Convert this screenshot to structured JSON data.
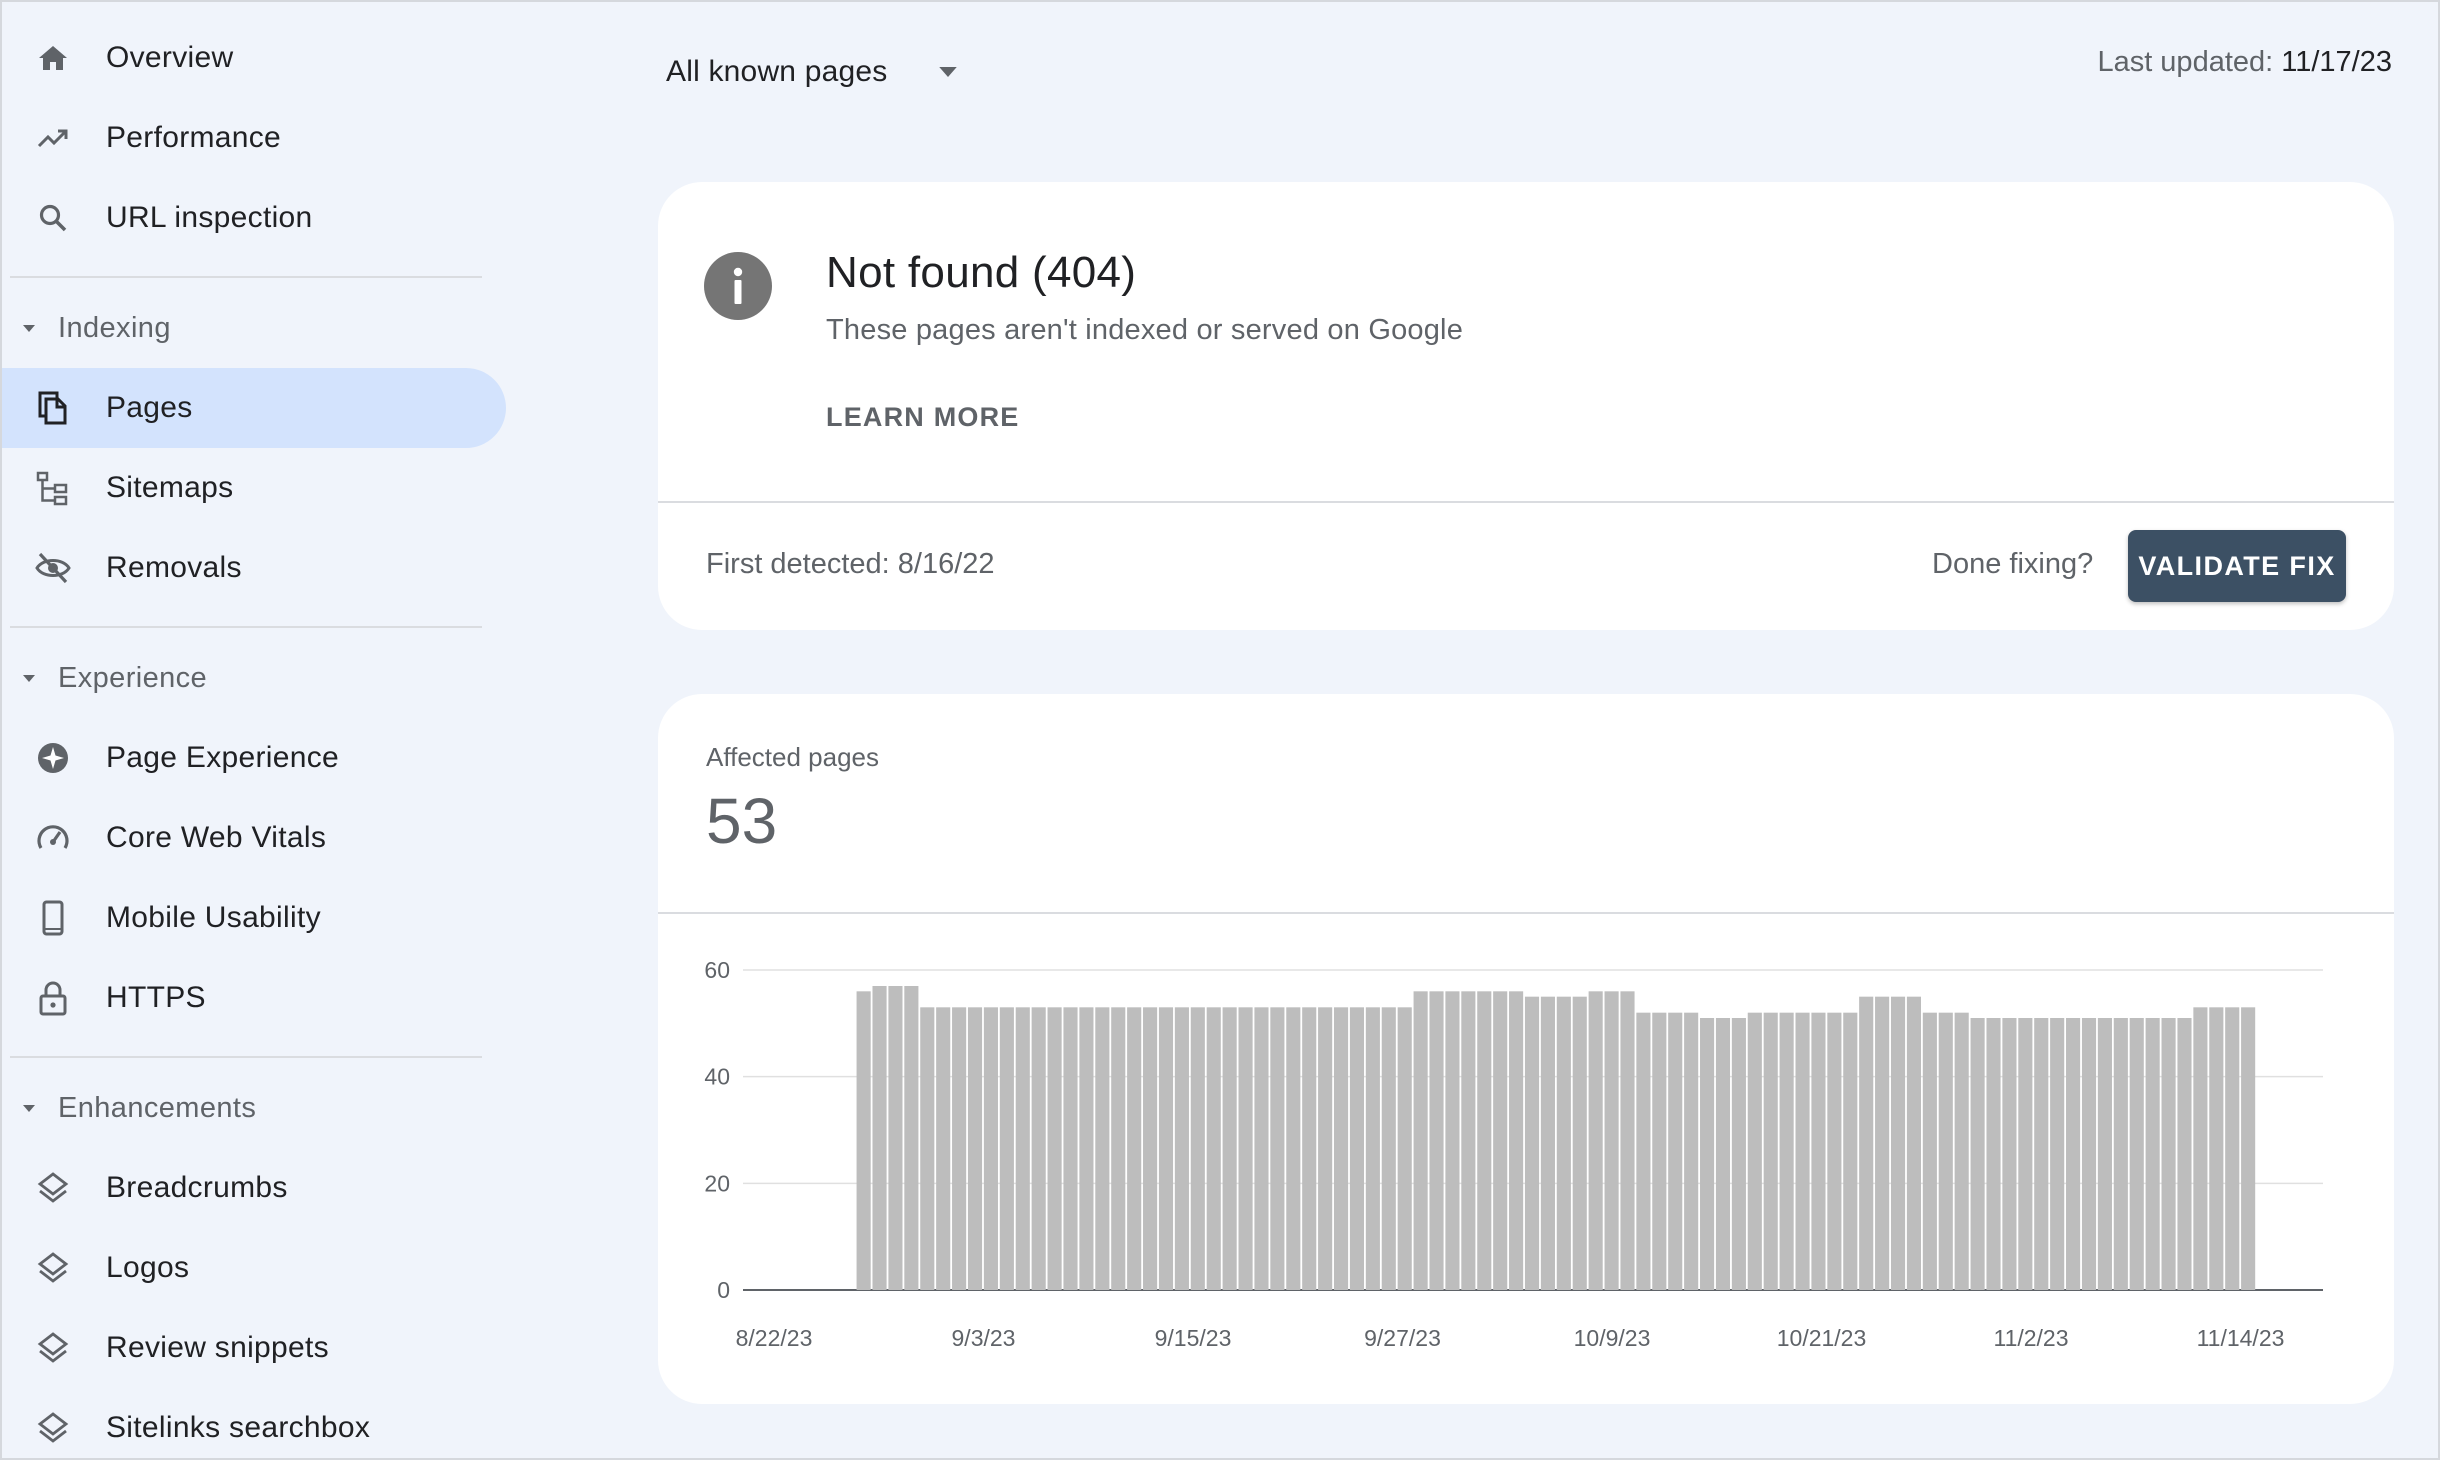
{
  "sidebar": {
    "top_items": [
      {
        "label": "Overview",
        "icon": "home-icon"
      },
      {
        "label": "Performance",
        "icon": "trending-up-icon"
      },
      {
        "label": "URL inspection",
        "icon": "search-icon"
      }
    ],
    "sections": [
      {
        "label": "Indexing",
        "items": [
          {
            "label": "Pages",
            "icon": "pages-icon",
            "active": true
          },
          {
            "label": "Sitemaps",
            "icon": "sitemap-icon"
          },
          {
            "label": "Removals",
            "icon": "visibility-off-icon"
          }
        ]
      },
      {
        "label": "Experience",
        "items": [
          {
            "label": "Page Experience",
            "icon": "sparkle-icon"
          },
          {
            "label": "Core Web Vitals",
            "icon": "speed-gauge-icon"
          },
          {
            "label": "Mobile Usability",
            "icon": "smartphone-icon"
          },
          {
            "label": "HTTPS",
            "icon": "lock-icon"
          }
        ]
      },
      {
        "label": "Enhancements",
        "items": [
          {
            "label": "Breadcrumbs",
            "icon": "layers-icon"
          },
          {
            "label": "Logos",
            "icon": "layers-icon"
          },
          {
            "label": "Review snippets",
            "icon": "layers-icon"
          },
          {
            "label": "Sitelinks searchbox",
            "icon": "layers-icon"
          }
        ]
      }
    ]
  },
  "topbar": {
    "filter_label": "All known pages",
    "last_updated_label": "Last updated:",
    "last_updated_value": "11/17/23"
  },
  "issue": {
    "title": "Not found (404)",
    "description": "These pages aren't indexed or served on Google",
    "learn_more": "LEARN MORE",
    "first_detected": "First detected: 8/16/22",
    "done_fixing": "Done fixing?",
    "validate_button": "VALIDATE FIX"
  },
  "affected": {
    "label": "Affected pages",
    "count": "53"
  },
  "colors": {
    "background": "#f0f4fb",
    "active_nav": "#d3e3fd",
    "validate_button": "#3c5064",
    "bar": "#bdbdbd",
    "info_icon": "#757575"
  },
  "chart_data": {
    "type": "bar",
    "title": "",
    "xlabel": "",
    "ylabel": "",
    "ylim": [
      0,
      60
    ],
    "yticks": [
      0,
      20,
      40,
      60
    ],
    "grid": true,
    "x_tick_labels": [
      "8/22/23",
      "9/3/23",
      "9/15/23",
      "9/27/23",
      "10/9/23",
      "10/21/23",
      "11/2/23",
      "11/14/23"
    ],
    "x_start": "8/22/23",
    "x_end": "11/18/23",
    "series": [
      {
        "values": [
          0,
          0,
          0,
          0,
          0,
          56,
          57,
          57,
          57,
          53,
          53,
          53,
          53,
          53,
          53,
          53,
          53,
          53,
          53,
          53,
          53,
          53,
          53,
          53,
          53,
          53,
          53,
          53,
          53,
          53,
          53,
          53,
          53,
          53,
          53,
          53,
          53,
          53,
          53,
          53,
          56,
          56,
          56,
          56,
          56,
          56,
          56,
          55,
          55,
          55,
          55,
          56,
          56,
          56,
          52,
          52,
          52,
          52,
          51,
          51,
          51,
          52,
          52,
          52,
          52,
          52,
          52,
          52,
          55,
          55,
          55,
          55,
          52,
          52,
          52,
          51,
          51,
          51,
          51,
          51,
          51,
          51,
          51,
          51,
          51,
          51,
          51,
          51,
          51,
          53,
          53,
          53,
          53
        ]
      }
    ]
  }
}
